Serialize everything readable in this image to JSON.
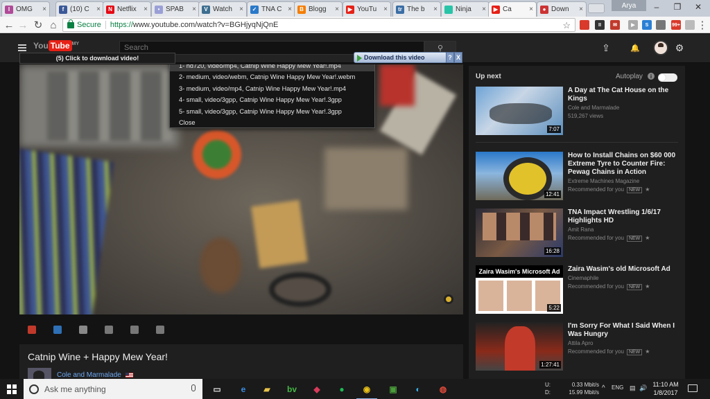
{
  "browser": {
    "tabs": [
      {
        "label": "OMG",
        "color": "#b04a98",
        "glyph": "I"
      },
      {
        "label": "(10) C",
        "color": "#3b5998",
        "glyph": "f"
      },
      {
        "label": "Netflix",
        "color": "#e50914",
        "glyph": "N"
      },
      {
        "label": "SPAB",
        "color": "#9aa0d6",
        "glyph": "•"
      },
      {
        "label": "Watch",
        "color": "#3d6e8f",
        "glyph": "V"
      },
      {
        "label": "TNA C",
        "color": "#2a79c9",
        "glyph": "✓"
      },
      {
        "label": "Blogg",
        "color": "#f57d00",
        "glyph": "B"
      },
      {
        "label": "YouTu",
        "color": "#e62117",
        "glyph": "▶"
      },
      {
        "label": "The b",
        "color": "#3b6ea5",
        "glyph": "tr"
      },
      {
        "label": "Ninja",
        "color": "#28c4a8",
        "glyph": ""
      },
      {
        "label": "Ca",
        "color": "#e62117",
        "glyph": "▶",
        "active": true
      },
      {
        "label": "Down",
        "color": "#cc3333",
        "glyph": "●"
      }
    ],
    "close_glyph": "×",
    "profile": "Arya",
    "window_buttons": [
      "–",
      "❐",
      "✕"
    ],
    "nav": {
      "back": "←",
      "forward": "→",
      "reload": "↻",
      "home": "⌂"
    },
    "secure_label": "Secure",
    "url_scheme": "https://",
    "url_rest": "www.youtube.com/watch?v=BGHjyqNjQnE",
    "star": "☆",
    "menu": "⋮",
    "ext_icons": [
      {
        "name": "ext-red-icon",
        "color": "#d93a2b",
        "text": ""
      },
      {
        "name": "ext-timer-icon",
        "color": "#333333",
        "text": "II"
      },
      {
        "name": "ext-mail-icon",
        "color": "#c0392b",
        "text": "✉"
      },
      {
        "name": "ext-play-icon",
        "color": "#aaaaaa",
        "text": "▶"
      },
      {
        "name": "ext-s-icon",
        "color": "#2a7fd4",
        "text": "S"
      },
      {
        "name": "ext-grey-icon",
        "color": "#777777",
        "text": ""
      },
      {
        "name": "ext-badge-icon",
        "color": "#d93a2b",
        "text": "99+"
      },
      {
        "name": "ext-cloud-icon",
        "color": "#bbbbbb",
        "text": ""
      }
    ]
  },
  "youtube": {
    "logo_text": "You",
    "logo_tube": "Tube",
    "logo_suffix": "MY",
    "search_placeholder": "Search",
    "search_icon": "⚲",
    "upload_icon": "⇪",
    "bell_icon": "🔔",
    "gear_icon": "⚙"
  },
  "downloader": {
    "strip_label": "(5) Click to download video!",
    "button_label": "Download this video",
    "help": "?",
    "close": "X",
    "options": [
      "1- hd720, video/mp4, Catnip Wine   Happy Mew Year!.mp4",
      "2- medium, video/webm, Catnip Wine   Happy Mew Year!.webm",
      "3- medium, video/mp4, Catnip Wine   Happy Mew Year!.mp4",
      "4- small, video/3gpp, Catnip Wine   Happy Mew Year!.3gpp",
      "5- small, video/3gpp, Catnip Wine   Happy Mew Year!.3gpp",
      "Close"
    ]
  },
  "video": {
    "title": "Catnip Wine + Happy Mew Year!",
    "channel": "Cole and Marmalade",
    "controls": [
      {
        "name": "red-ext-control-icon",
        "color": "#c0392b"
      },
      {
        "name": "blue-ext-control-icon",
        "color": "#2e6fb5"
      },
      {
        "name": "settings-control-icon",
        "color": "#888888"
      },
      {
        "name": "image-control-icon",
        "color": "#777777"
      },
      {
        "name": "loop-control-icon",
        "color": "#777777"
      },
      {
        "name": "screenshot-control-icon",
        "color": "#777777"
      }
    ]
  },
  "sidebar": {
    "up_next": "Up next",
    "autoplay": "Autoplay",
    "autoplay_info": "i",
    "items": [
      {
        "title": "A Day at The Cat House on the Kings",
        "channel": "Cole and Marmalade",
        "meta": "519,267 views",
        "duration": "7:07",
        "new": false
      },
      {
        "title": "How to Install Chains on $60 000 Extreme Tyre to Counter Fire: Pewag Chains in Action",
        "channel": "Extreme Machines Magazine",
        "meta": "Recommended for you",
        "duration": "12:41",
        "new": true
      },
      {
        "title": "TNA Impact Wrestling 1/6/17 Highlights HD",
        "channel": "Amit Rana",
        "meta": "Recommended for you",
        "duration": "16:28",
        "new": true
      },
      {
        "title": "Zaira Wasim's old Microsoft Ad",
        "channel": "Cinemaphile",
        "meta": "Recommended for you",
        "duration": "5:22",
        "new": true,
        "thumb_caption": "Zaira Wasim's Microsoft Ad"
      },
      {
        "title": "I'm Sorry For What I Said When I Was Hungry",
        "channel": "Attila Apro",
        "meta": "Recommended for you",
        "duration": "1:27:41",
        "new": true
      }
    ],
    "new_label": "NEW",
    "star": "★"
  },
  "taskbar": {
    "search_placeholder": "Ask me anything",
    "up_label": "U:",
    "down_label": "D:",
    "up_rate": "0.33 Mbit/s",
    "down_rate": "15.99 Mbit/s",
    "time": "11:10 AM",
    "date": "1/8/2017",
    "tray_up": "^",
    "tray_lang": "ENG",
    "tray_sound": "🔊"
  }
}
